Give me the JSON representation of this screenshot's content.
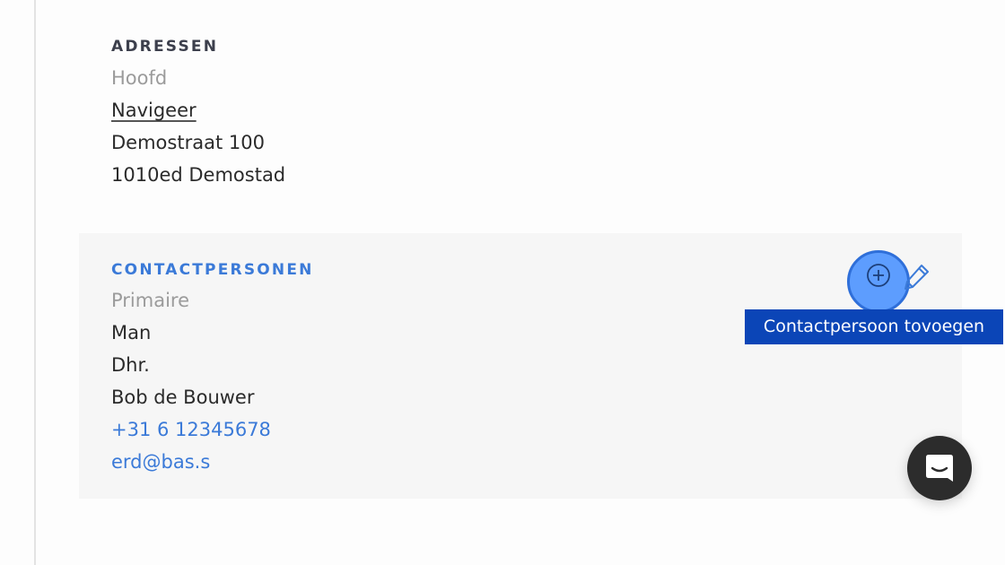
{
  "addresses": {
    "heading": "ADRESSEN",
    "type_label": "Hoofd",
    "navigate_link": "Navigeer",
    "street": "Demostraat 100",
    "postal_city": "1010ed Demostad"
  },
  "contacts": {
    "heading": "CONTACTPERSONEN",
    "type_label": "Primaire",
    "gender": "Man",
    "salutation": "Dhr.",
    "name": "Bob de Bouwer",
    "phone": "+31 6 12345678",
    "email": "erd@bas.s"
  },
  "actions": {
    "add_icon": "plus-circle-icon",
    "edit_icon": "pencil-icon",
    "add_tooltip": "Contactpersoon tovoegen"
  },
  "chat": {
    "icon": "chat-bubble-icon"
  },
  "colors": {
    "accent": "#3b7ad8",
    "tooltip_bg": "#0b45b7",
    "highlight": "#4d94ff"
  }
}
